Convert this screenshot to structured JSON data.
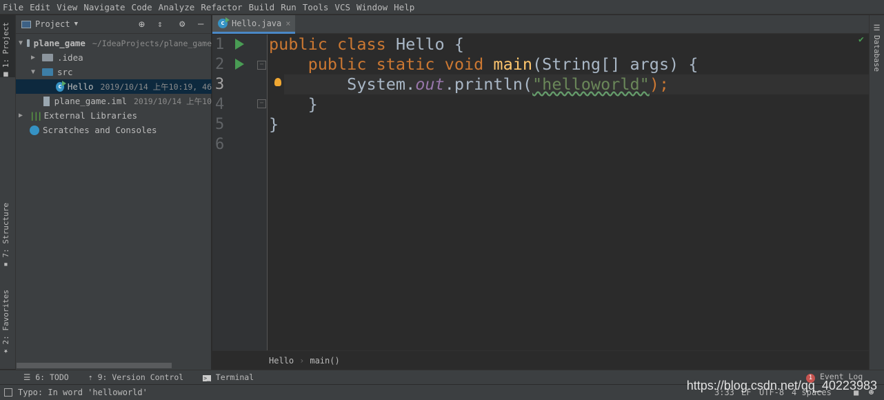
{
  "menu": [
    "File",
    "Edit",
    "View",
    "Navigate",
    "Code",
    "Analyze",
    "Refactor",
    "Build",
    "Run",
    "Tools",
    "VCS",
    "Window",
    "Help"
  ],
  "left_tabs": {
    "project": "1: Project",
    "structure": "7: Structure",
    "favorites": "2: Favorites"
  },
  "project_panel": {
    "title": "Project",
    "tree": [
      {
        "label": "plane_game",
        "meta": "~/IdeaProjects/plane_game"
      },
      {
        "label": ".idea"
      },
      {
        "label": "src"
      },
      {
        "label": "Hello",
        "meta": "2019/10/14 上午10:19, 46",
        "selected": true
      },
      {
        "label": "plane_game.iml",
        "meta": "2019/10/14 上午10"
      },
      {
        "label": "External Libraries"
      },
      {
        "label": "Scratches and Consoles"
      }
    ]
  },
  "editor": {
    "tab": "Hello.java",
    "line_numbers": [
      "1",
      "2",
      "3",
      "4",
      "5",
      "6"
    ],
    "code": {
      "l1_kw": "public class ",
      "l1_name": "Hello {",
      "l2_kw": "    public static void ",
      "l2_method": "main",
      "l2_rest": "(String[] args) {",
      "l3_a": "        System.",
      "l3_field": "out",
      "l3_b": ".println(",
      "l3_str": "\"helloworld\"",
      "l3_c": ");",
      "l4": "    }",
      "l5": "}"
    },
    "breadcrumb": [
      "Hello",
      "main()"
    ]
  },
  "right_tabs": {
    "database": "Database"
  },
  "bottom_tools": {
    "todo": "6: TODO",
    "vcs": "9: Version Control",
    "terminal": "Terminal",
    "event_log": "Event Log",
    "event_count": "1"
  },
  "status": {
    "message": "Typo: In word 'helloworld'",
    "position": "3:33",
    "line_sep": "LF",
    "encoding": "UTF-8",
    "indent": "4 spaces"
  },
  "watermark": "https://blog.csdn.net/qq_40223983",
  "colors": {
    "keyword": "#CC7832",
    "method": "#FFC66D",
    "string": "#6A8759",
    "field": "#9876AA",
    "accent": "#4A88C7",
    "run": "#499C54"
  }
}
